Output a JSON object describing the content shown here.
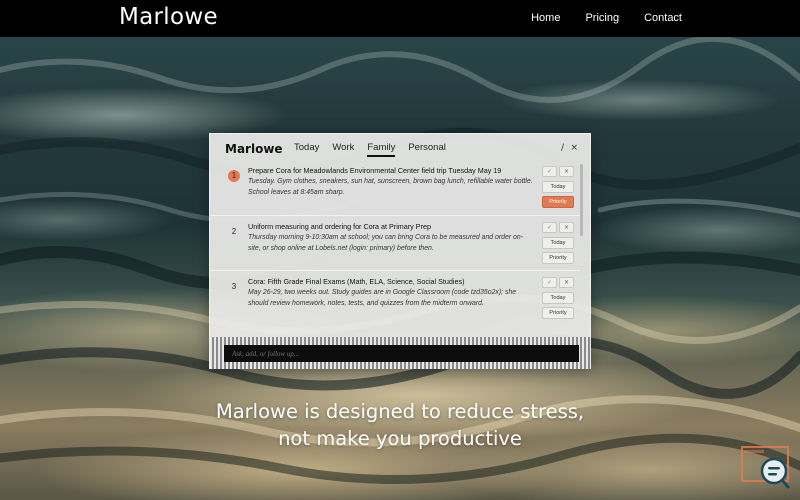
{
  "site": {
    "brand": "Marlowe",
    "nav": [
      "Home",
      "Pricing",
      "Contact"
    ]
  },
  "panel": {
    "title": "Marlowe",
    "tabs": [
      "Today",
      "Work",
      "Family",
      "Personal"
    ],
    "active_tab": "Family",
    "controls": {
      "edit": "/",
      "close": "×"
    },
    "tasks": [
      {
        "num": "1",
        "title": "Prepare Cora for Meadowlands Environmental Center field trip Tuesday May 19",
        "desc": "Tuesday. Gym clothes, sneakers, sun hat, sunscreen, brown bag lunch, refillable water bottle. School leaves at 8:45am sharp.",
        "priority_active": true
      },
      {
        "num": "2",
        "title": "Uniform measuring and ordering for Cora at Primary Prep",
        "desc": "Thursday morning 9-10:30am at school; you can bring Cora to be measured and order on-site, or shop online at Lobels.net (login: primary) before then.",
        "priority_active": false
      },
      {
        "num": "3",
        "title": "Cora: Fifth Grade Final Exams (Math, ELA, Science, Social Studies)",
        "desc": "May 26-29, two weeks out. Study guides are in Google Classroom (code tzd35o2x); she should review homework, notes, tests, and quizzes from the midterm onward.",
        "priority_active": false
      }
    ],
    "button_labels": {
      "check": "✓",
      "delete": "×",
      "today": "Today",
      "priority": "Priority"
    },
    "input_placeholder": "Ask, add, or follow up..."
  },
  "headline": {
    "line1": "Marlowe is designed to reduce stress,",
    "line2": "not make you productive"
  },
  "colors": {
    "accent": "#e07a55",
    "nav_bg": "#000000",
    "panel_bg": "#ececea"
  },
  "icons": [
    "chat-support-icon"
  ]
}
